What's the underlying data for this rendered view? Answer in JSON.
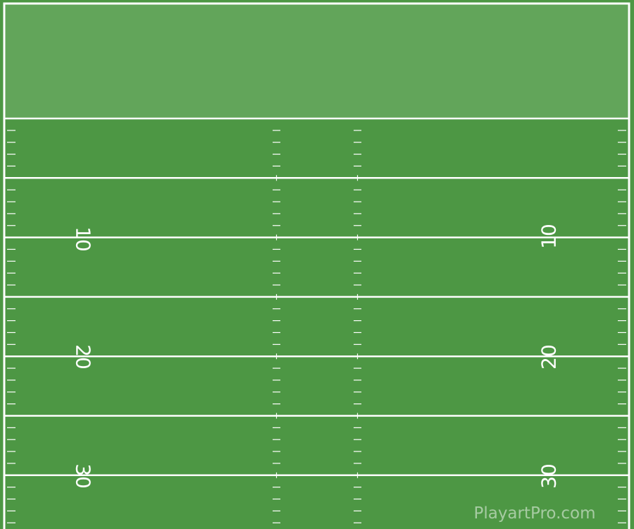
{
  "field": {
    "colors": {
      "endzone": "#62a55a",
      "turf": "#4d9744",
      "lines": "#ffffff"
    },
    "yard_numbers": {
      "left": [
        "10",
        "20",
        "30"
      ],
      "right": [
        "10",
        "20",
        "30"
      ]
    }
  },
  "watermark": "PlayartPro.com"
}
